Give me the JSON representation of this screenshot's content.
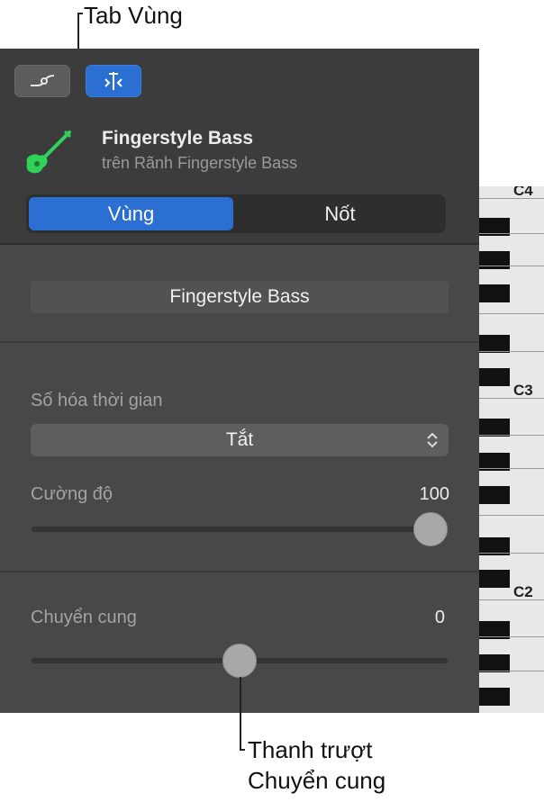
{
  "callouts": {
    "region_tab": "Tab Vùng",
    "transpose_slider_line1": "Thanh trượt",
    "transpose_slider_line2": "Chuyển cung"
  },
  "toolbar": {
    "automation_icon": "automation-curve-icon",
    "inspector_icon": "region-inspector-icon"
  },
  "track": {
    "icon": "bass-guitar-icon",
    "name": "Fingerstyle Bass",
    "subtitle": "trên Rãnh Fingerstyle Bass"
  },
  "tabs": [
    {
      "label": "Vùng",
      "active": true
    },
    {
      "label": "Nốt",
      "active": false
    }
  ],
  "region_name": "Fingerstyle Bass",
  "quantize": {
    "label": "Số hóa thời gian",
    "selected": "Tắt"
  },
  "velocity": {
    "label": "Cường độ",
    "value": "100",
    "level": 1.0
  },
  "transpose": {
    "label": "Chuyển cung",
    "value": "0",
    "level": 0.5
  },
  "keyboard": {
    "labels": [
      "C4",
      "C3",
      "C2"
    ]
  },
  "colors": {
    "accent": "#2b6fd3",
    "panel": "#484848",
    "bass_icon": "#2fd35a"
  }
}
